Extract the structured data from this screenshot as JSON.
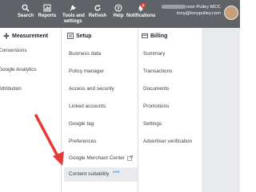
{
  "toolbar": {
    "items": [
      {
        "label": "Search",
        "icon": "search-icon"
      },
      {
        "label": "Reports",
        "icon": "bar-chart-icon"
      },
      {
        "label": "Tools and settings",
        "label_line1": "Tools and",
        "label_line2": "settings",
        "icon": "wrench-icon"
      },
      {
        "label": "Refresh",
        "icon": "refresh-icon"
      },
      {
        "label": "Help",
        "icon": "help-icon"
      },
      {
        "label": "Notifications",
        "icon": "bell-icon",
        "badge": "1"
      }
    ],
    "account_name": "rson Pulley MCC",
    "account_email": "tony@tonypulley.com"
  },
  "menu": {
    "measurement": {
      "title": "Measurement",
      "icon": "measurement-icon",
      "items": [
        "Conversions",
        "Google Analytics",
        "Attribution"
      ]
    },
    "setup": {
      "title": "Setup",
      "icon": "setup-icon",
      "items": [
        "Business data",
        "Policy manager",
        "Access and security",
        "Linked accounts",
        "Google tag",
        "Preferences",
        "Google Merchant Center",
        "Content suitability"
      ],
      "new_badge": "new"
    },
    "billing": {
      "title": "Billing",
      "icon": "billing-icon",
      "items": [
        "Summary",
        "Transactions",
        "Documents",
        "Promotions",
        "Settings",
        "Advertiser verification"
      ]
    }
  },
  "colors": {
    "toolbar_bg": "#5f6368",
    "arrow": "#e53935",
    "highlight": "#e8eaed",
    "new_badge": "#1a73e8"
  }
}
